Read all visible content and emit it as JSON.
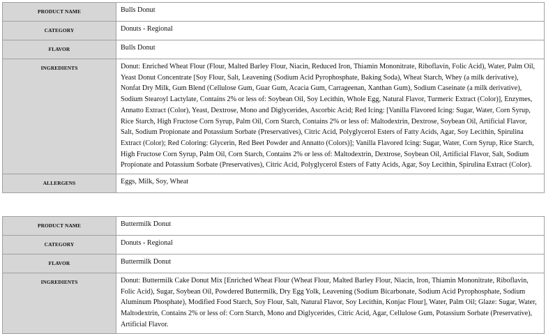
{
  "products": [
    {
      "rows": [
        {
          "label": "PRODUCT NAME",
          "value": "Bulls Donut"
        },
        {
          "label": "CATEGORY",
          "value": "Donuts - Regional"
        },
        {
          "label": "FLAVOR",
          "value": "Bulls Donut"
        },
        {
          "label": "INGREDIENTS",
          "value": "Donut: Enriched Wheat Flour (Flour, Malted Barley Flour, Niacin, Reduced Iron, Thiamin Mononitrate, Riboflavin, Folic Acid), Water, Palm Oil, Yeast Donut Concentrate [Soy Flour, Salt, Leavening (Sodium Acid Pyrophosphate, Baking Soda), Wheat Starch, Whey (a milk derivative), Nonfat Dry Milk, Gum Blend (Cellulose Gum, Guar Gum, Acacia Gum, Carrageenan, Xanthan Gum), Sodium Caseinate (a milk derivative), Sodium Stearoyl Lactylate, Contains 2% or less of: Soybean Oil, Soy Lecithin, Whole Egg, Natural Flavor, Turmeric Extract (Color)], Enzymes, Annatto Extract (Color), Yeast, Dextrose, Mono and Diglycerides, Ascorbic Acid; Red Icing: [Vanilla Flavored Icing: Sugar, Water, Corn Syrup, Rice Starch, High Fructose Corn Syrup, Palm Oil, Corn Starch, Contains 2% or less of: Maltodextrin, Dextrose, Soybean Oil, Artificial Flavor, Salt, Sodium Propionate and Potassium Sorbate (Preservatives), Citric Acid, Polyglycerol Esters of Fatty Acids, Agar, Soy Lecithin, Spirulina Extract (Color); Red Coloring: Glycerin, Red Beet Powder and Annatto (Colors)]; Vanilla Flavored Icing: Sugar, Water, Corn Syrup, Rice Starch, High Fructose Corn Syrup, Palm Oil, Corn Starch, Contains 2% or less of: Maltodextrin, Dextrose, Soybean Oil, Artificial Flavor, Salt, Sodium Propionate and Potassium Sorbate (Preservatives), Citric Acid, Polyglycerol Esters of Fatty Acids, Agar, Soy Lecithin, Spirulina Extract (Color)."
        },
        {
          "label": "ALLERGENS",
          "value": "Eggs, Milk, Soy, Wheat"
        }
      ]
    },
    {
      "rows": [
        {
          "label": "PRODUCT NAME",
          "value": "Buttermilk Donut"
        },
        {
          "label": "CATEGORY",
          "value": "Donuts - Regional"
        },
        {
          "label": "FLAVOR",
          "value": "Buttermilk Donut"
        },
        {
          "label": "INGREDIENTS",
          "value": "Donut: Buttermilk Cake Donut Mix [Enriched Wheat Flour (Wheat Flour, Malted Barley Flour, Niacin, Iron, Thiamin Mononitrate, Riboflavin, Folic Acid), Sugar, Soybean Oil, Powdered Buttermilk, Dry Egg Yolk, Leavening (Sodium Bicarbonate, Sodium Acid Pyrophosphate, Sodium Aluminum Phosphate), Modified Food Starch, Soy Flour, Salt, Natural Flavor, Soy Lecithin, Konjac Flour], Water, Palm Oil; Glaze: Sugar, Water, Maltodextrin, Contains 2% or less of: Corn Starch, Mono and Diglycerides, Citric Acid, Agar, Cellulose Gum, Potassium Sorbate (Preservative), Artificial Flavor."
        }
      ]
    }
  ]
}
